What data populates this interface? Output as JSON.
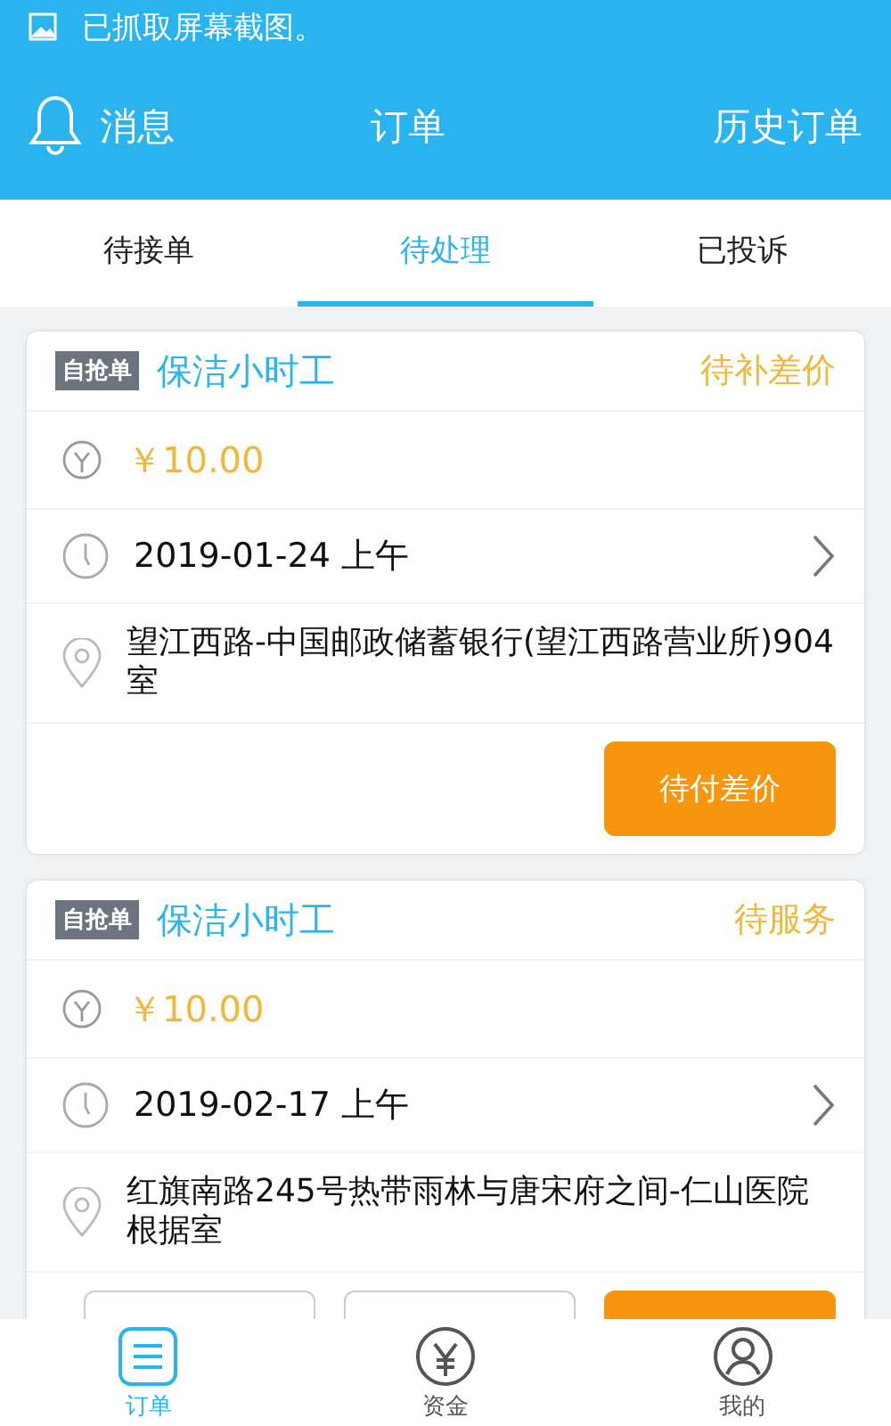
{
  "status_bar": {
    "notification": "已抓取屏幕截图。"
  },
  "header": {
    "left": "消息",
    "title": "订单",
    "right": "历史订单"
  },
  "tabs": [
    {
      "label": "待接单",
      "selected": false
    },
    {
      "label": "待处理",
      "selected": true
    },
    {
      "label": "已投诉",
      "selected": false
    }
  ],
  "orders": [
    {
      "tag": "自抢单",
      "service": "保洁小时工",
      "status": "待补差价",
      "price": "￥10.00",
      "date": "2019-01-24 上午",
      "address": "望江西路-中国邮政储蓄银行(望江西路营业所)904室",
      "actions": [
        {
          "kind": "primary",
          "label": "待付差价"
        }
      ]
    },
    {
      "tag": "自抢单",
      "service": "保洁小时工",
      "status": "待服务",
      "price": "￥10.00",
      "date": "2019-02-17 上午",
      "address": "红旗南路245号热带雨林与唐宋府之间-仁山医院根据室",
      "actions": [
        {
          "kind": "outline"
        },
        {
          "kind": "outline"
        },
        {
          "kind": "primary"
        }
      ]
    }
  ],
  "bottom_nav": [
    {
      "label": "订单",
      "selected": true,
      "kind": "orders"
    },
    {
      "label": "资金",
      "selected": false,
      "kind": "funds"
    },
    {
      "label": "我的",
      "selected": false,
      "kind": "profile"
    }
  ]
}
